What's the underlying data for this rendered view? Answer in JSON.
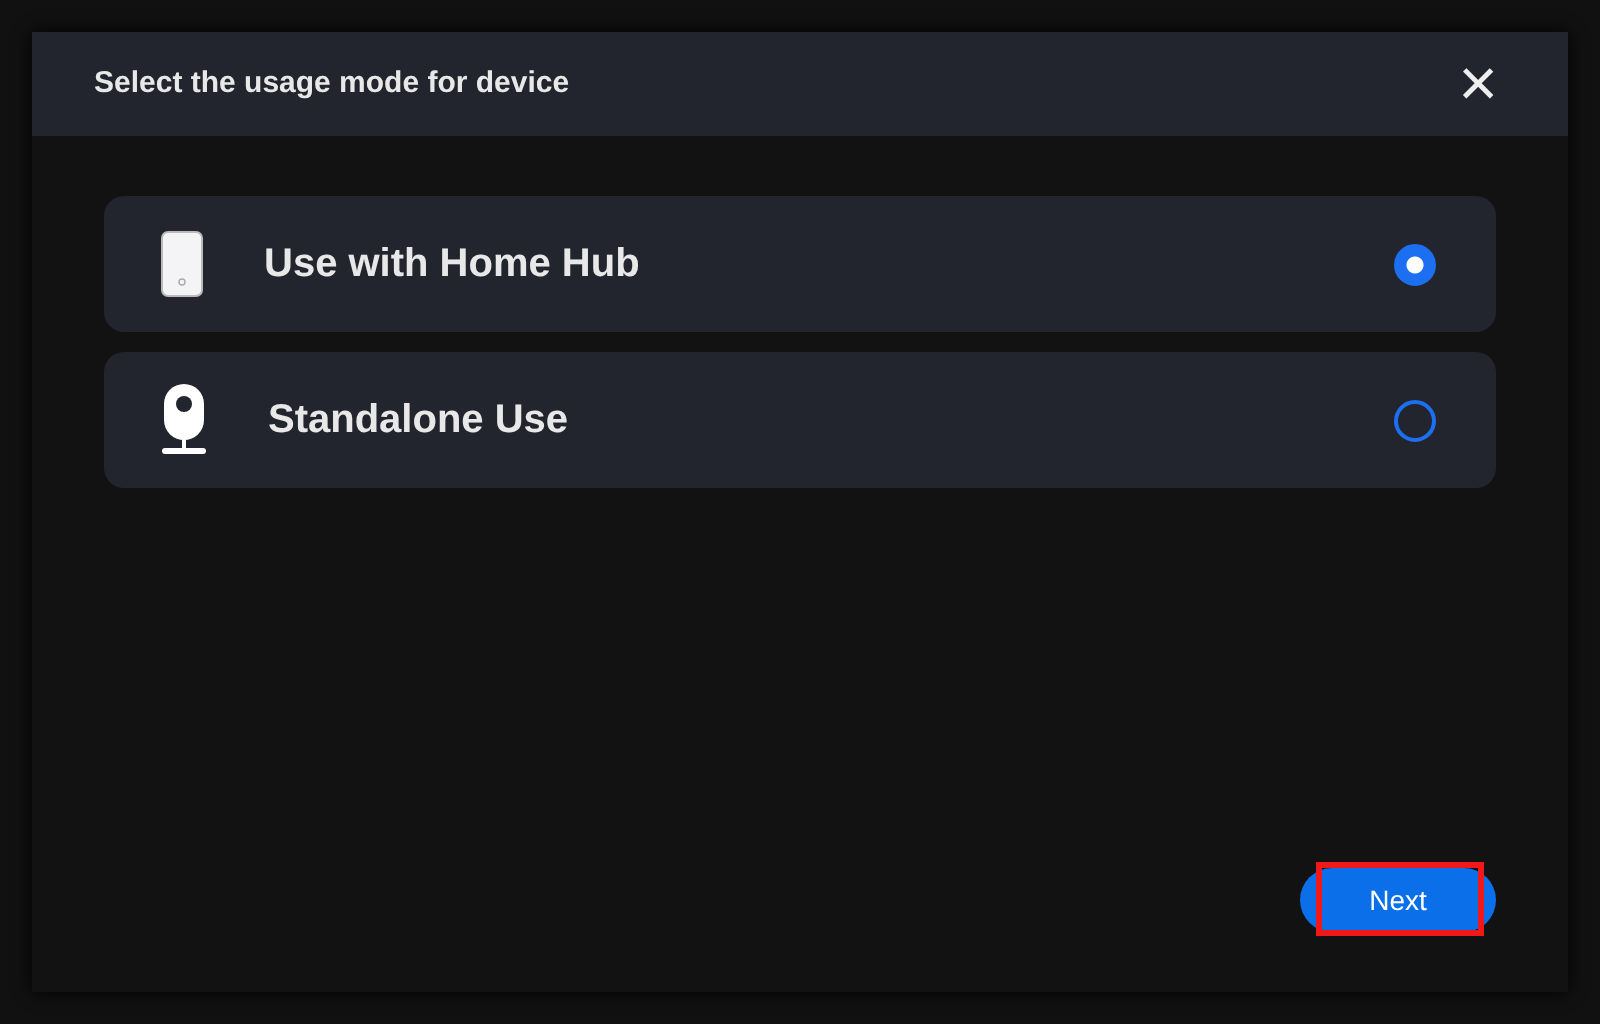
{
  "dialog": {
    "title": "Select the usage mode for device",
    "close": "×"
  },
  "options": [
    {
      "kind": "hub",
      "label": "Use with Home Hub",
      "selected": true
    },
    {
      "kind": "camera",
      "label": "Standalone Use",
      "selected": false
    }
  ],
  "next_button": {
    "label": "Next",
    "highlighted": true
  }
}
